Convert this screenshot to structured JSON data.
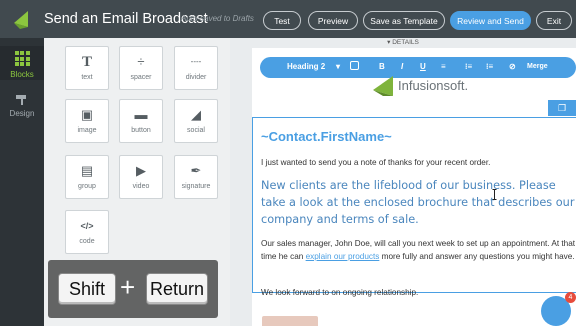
{
  "header": {
    "title": "Send an Email Broadcast",
    "autosave": "Auto-saved to Drafts",
    "buttons": {
      "test": "Test",
      "preview": "Preview",
      "save_template": "Save as Template",
      "review_send": "Review and Send",
      "exit": "Exit"
    }
  },
  "rail": {
    "blocks": "Blocks",
    "design": "Design"
  },
  "blocks": {
    "items": [
      {
        "label": "text",
        "icon": "T"
      },
      {
        "label": "spacer",
        "icon": "÷"
      },
      {
        "label": "divider",
        "icon": "----"
      },
      {
        "label": "image",
        "icon": "▣"
      },
      {
        "label": "button",
        "icon": "▬"
      },
      {
        "label": "social",
        "icon": "◢"
      },
      {
        "label": "group",
        "icon": "▤"
      },
      {
        "label": "video",
        "icon": "▶"
      },
      {
        "label": "signature",
        "icon": "✒"
      },
      {
        "label": "code",
        "icon": "</>"
      }
    ]
  },
  "keyboard": {
    "key1": "Shift",
    "plus": "+",
    "key2": "Return"
  },
  "editor": {
    "details": "▾ DETAILS",
    "toolbar": {
      "heading": "Heading 2",
      "merge": "Merge"
    },
    "brand": "Infusionsoft."
  },
  "email": {
    "greeting": "~Contact.FirstName~",
    "intro": "I just wanted to send you a note of thanks for your recent order.",
    "highlight": "New clients are the lifeblood of our business. Please take a look at the enclosed brochure that describes our company and terms of sale.",
    "para2_before": "Our sales manager, John Doe, will call you next week to set up an appointment. At that time he can ",
    "para2_link": "explain our products",
    "para2_after": " more fully and answer any questions you might have.",
    "closing": "We look forward to on ongoing relationship."
  },
  "chat": {
    "badge": "4"
  },
  "colors": {
    "accent": "#4a9fe3",
    "brand_green": "#8cc63f",
    "topbar": "#414a4f"
  }
}
